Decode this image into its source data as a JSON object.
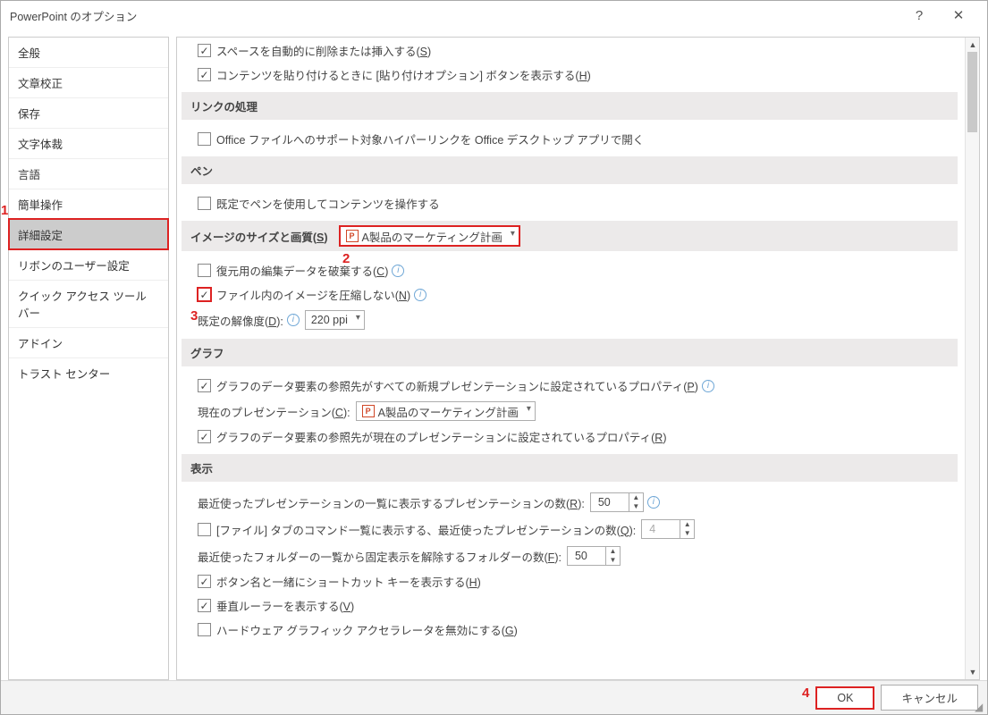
{
  "window": {
    "title": "PowerPoint のオプション"
  },
  "sidebar": {
    "items": [
      "全般",
      "文章校正",
      "保存",
      "文字体裁",
      "言語",
      "簡単操作",
      "詳細設定",
      "リボンのユーザー設定",
      "クイック アクセス ツール バー",
      "アドイン",
      "トラスト センター"
    ],
    "selected_index": 6
  },
  "content": {
    "top_checks": [
      {
        "checked": true,
        "label": "スペースを自動的に削除または挿入する(",
        "accel": "S",
        "tail": ")"
      },
      {
        "checked": true,
        "label": "コンテンツを貼り付けるときに [貼り付けオプション] ボタンを表示する(",
        "accel": "H",
        "tail": ")"
      }
    ],
    "sections": {
      "link": {
        "title": "リンクの処理",
        "items": [
          {
            "checked": false,
            "label": "Office ファイルへのサポート対象ハイパーリンクを Office デスクトップ アプリで開く"
          }
        ]
      },
      "pen": {
        "title": "ペン",
        "items": [
          {
            "checked": false,
            "label": "既定でペンを使用してコンテンツを操作する"
          }
        ]
      },
      "image": {
        "title_pre": "イメージのサイズと画質(",
        "title_accel": "S",
        "title_post": ")",
        "target": "A製品のマーケティング計画",
        "discard": {
          "checked": false,
          "label": "復元用の編集データを破棄する(",
          "accel": "C",
          "tail": ")"
        },
        "nocompress": {
          "checked": true,
          "label": "ファイル内のイメージを圧縮しない(",
          "accel": "N",
          "tail": ")"
        },
        "resolution": {
          "label": "既定の解像度(",
          "accel": "D",
          "tail": "):",
          "value": "220 ppi"
        }
      },
      "chart": {
        "title": "グラフ",
        "prop_all": {
          "checked": true,
          "label": "グラフのデータ要素の参照先がすべての新規プレゼンテーションに設定されているプロパティ(",
          "accel": "P",
          "tail": ")"
        },
        "current_label": {
          "pre": "現在のプレゼンテーション(",
          "accel": "C",
          "tail": "):"
        },
        "current_value": "A製品のマーケティング計画",
        "prop_cur": {
          "checked": true,
          "label": "グラフのデータ要素の参照先が現在のプレゼンテーションに設定されているプロパティ(",
          "accel": "R",
          "tail": ")"
        }
      },
      "display": {
        "title": "表示",
        "recent_pres": {
          "label": "最近使ったプレゼンテーションの一覧に表示するプレゼンテーションの数(",
          "accel": "R",
          "tail": "):",
          "value": "50"
        },
        "file_tab": {
          "checked": false,
          "label": "[ファイル] タブのコマンド一覧に表示する、最近使ったプレゼンテーションの数(",
          "accel": "Q",
          "tail": "):",
          "value": "4"
        },
        "recent_folders": {
          "label": "最近使ったフォルダーの一覧から固定表示を解除するフォルダーの数(",
          "accel": "F",
          "tail": "):",
          "value": "50"
        },
        "shortcut": {
          "checked": true,
          "label": "ボタン名と一緒にショートカット キーを表示する(",
          "accel": "H",
          "tail": ")"
        },
        "ruler": {
          "checked": true,
          "label": "垂直ルーラーを表示する(",
          "accel": "V",
          "tail": ")"
        },
        "hw": {
          "checked": false,
          "label": "ハードウェア グラフィック アクセラレータを無効にする(",
          "accel": "G",
          "tail": ")"
        }
      }
    }
  },
  "footer": {
    "ok": "OK",
    "cancel": "キャンセル"
  },
  "annotations": {
    "a1": "1",
    "a2": "2",
    "a3": "3",
    "a4": "4"
  }
}
